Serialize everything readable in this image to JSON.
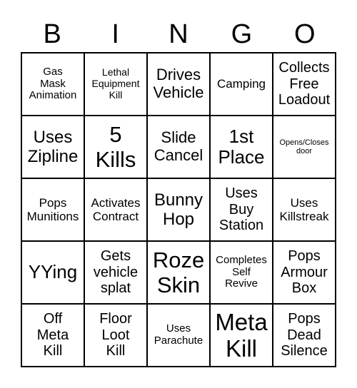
{
  "header": [
    "B",
    "I",
    "N",
    "G",
    "O"
  ],
  "cells": [
    "Gas\nMask\nAnimation",
    "Lethal\nEquipment\nKill",
    "Drives\nVehicle",
    "Camping",
    "Collects\nFree\nLoadout",
    "Uses\nZipline",
    "5\nKills",
    "Slide\nCancel",
    "1st\nPlace",
    "Opens/Closes\ndoor",
    "Pops\nMunitions",
    "Activates\nContract",
    "Bunny\nHop",
    "Uses\nBuy\nStation",
    "Uses\nKillstreak",
    "YYing",
    "Gets\nvehicle\nsplat",
    "Roze\nSkin",
    "Completes\nSelf\nRevive",
    "Pops\nArmour\nBox",
    "Off\nMeta\nKill",
    "Floor\nLoot\nKill",
    "Uses\nParachute",
    "Meta\nKill",
    "Pops\nDead\nSilence"
  ]
}
